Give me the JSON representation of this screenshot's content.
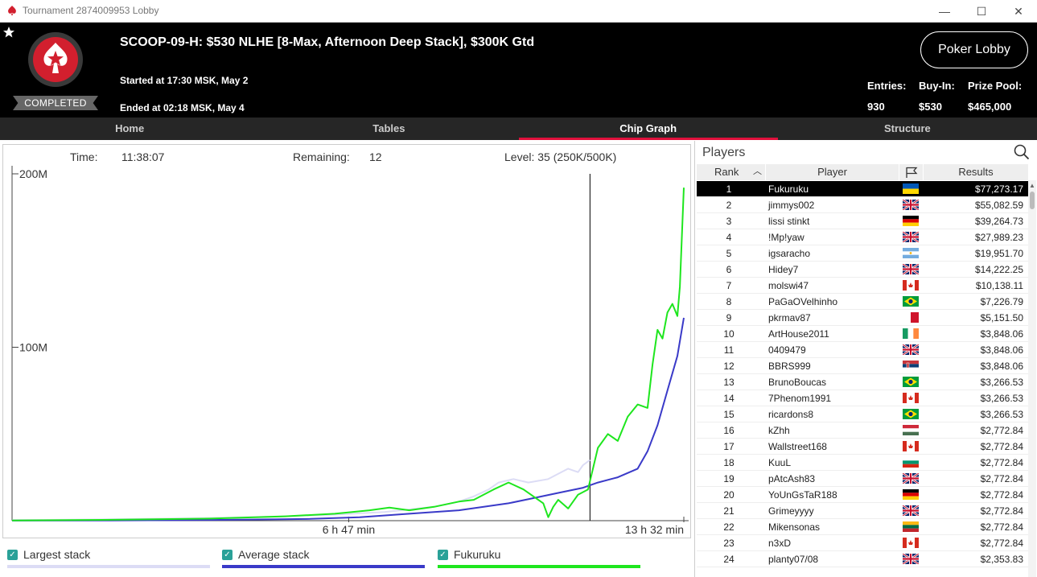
{
  "window": {
    "title": "Tournament 2874009953 Lobby",
    "controls": {
      "minimize": "—",
      "maximize": "☐",
      "close": "✕"
    }
  },
  "header": {
    "status_badge": "COMPLETED",
    "title": "SCOOP-09-H: $530 NLHE [8-Max, Afternoon Deep Stack], $300K Gtd",
    "started": "Started at 17:30 MSK, May 2",
    "ended": "Ended at 02:18 MSK, May 4",
    "lobby_button": "Poker Lobby",
    "stats": [
      {
        "label": "Entries:",
        "value": "930"
      },
      {
        "label": "Buy-In:",
        "value": "$530"
      },
      {
        "label": "Prize Pool:",
        "value": "$465,000"
      }
    ]
  },
  "tabs": [
    {
      "label": "Home",
      "active": false
    },
    {
      "label": "Tables",
      "active": false
    },
    {
      "label": "Chip Graph",
      "active": true
    },
    {
      "label": "Structure",
      "active": false
    }
  ],
  "chart_info": {
    "time_label": "Time:",
    "time_value": "11:38:07",
    "remaining_label": "Remaining:",
    "remaining_value": "12",
    "level_text": "Level: 35 (250K/500K)"
  },
  "chart_data": {
    "type": "line",
    "xlabel": "",
    "ylabel": "",
    "x_unit": "hours",
    "xlim": [
      0,
      13.53
    ],
    "ylim": [
      0,
      200
    ],
    "y_unit": "M chips",
    "y_ticks": [
      {
        "value": 100,
        "label": "100M"
      },
      {
        "value": 200,
        "label": "200M"
      }
    ],
    "x_ticks": [
      {
        "value": 6.78,
        "label": "6 h 47 min"
      },
      {
        "value": 13.53,
        "label": "13 h 32 min"
      }
    ],
    "cursor_x": 11.64,
    "grid": false,
    "legend_position": "bottom",
    "series": [
      {
        "name": "Largest stack",
        "color": "#dcdcf5",
        "x": [
          0,
          2,
          4,
          5.5,
          6.5,
          7.5,
          8.5,
          9.0,
          9.3,
          9.6,
          9.8,
          10.1,
          10.4,
          10.8,
          11.0,
          11.2,
          11.4,
          11.5,
          11.64
        ],
        "values": [
          0.3,
          0.8,
          1.5,
          2.5,
          3.5,
          5,
          8,
          11,
          14,
          18,
          22,
          24,
          22,
          24,
          27,
          30,
          28,
          32,
          35
        ]
      },
      {
        "name": "Average stack",
        "color": "#3a3ac8",
        "x": [
          0,
          2,
          4,
          6,
          7,
          8,
          9,
          9.5,
          10,
          10.5,
          11,
          11.5,
          11.8,
          12.2,
          12.6,
          12.8,
          13.0,
          13.2,
          13.4,
          13.53
        ],
        "values": [
          0.05,
          0.15,
          0.4,
          1.0,
          2,
          4,
          6,
          8,
          10,
          13,
          16,
          19,
          22,
          25,
          30,
          40,
          55,
          75,
          95,
          117
        ]
      },
      {
        "name": "Fukuruku",
        "color": "#1ee61e",
        "x": [
          0,
          2,
          4,
          5.5,
          6.5,
          7.2,
          7.6,
          8.0,
          8.5,
          9.0,
          9.3,
          9.7,
          10.0,
          10.3,
          10.5,
          10.7,
          10.8,
          10.9,
          11.0,
          11.2,
          11.4,
          11.6,
          11.8,
          12.0,
          12.2,
          12.4,
          12.6,
          12.8,
          12.9,
          13.0,
          13.1,
          13.2,
          13.3,
          13.4,
          13.45,
          13.53
        ],
        "values": [
          0.1,
          0.5,
          1.2,
          2.5,
          4,
          6,
          7.5,
          6,
          8,
          11,
          12,
          18,
          22,
          18,
          14,
          10,
          2,
          8,
          12,
          7,
          15,
          18,
          42,
          50,
          46,
          60,
          67,
          65,
          90,
          110,
          105,
          120,
          125,
          118,
          135,
          192
        ]
      }
    ]
  },
  "legend": [
    {
      "label": "Largest stack",
      "color": "#dcdcf5"
    },
    {
      "label": "Average stack",
      "color": "#3a3ac8"
    },
    {
      "label": "Fukuruku",
      "color": "#1ee61e"
    }
  ],
  "players": {
    "title": "Players",
    "headers": {
      "rank": "Rank",
      "player": "Player",
      "results": "Results"
    },
    "rows": [
      {
        "rank": "1",
        "name": "Fukuruku",
        "flag": "ua",
        "result": "$77,273.17",
        "selected": true
      },
      {
        "rank": "2",
        "name": "jimmys002",
        "flag": "gb",
        "result": "$55,082.59"
      },
      {
        "rank": "3",
        "name": "lissi stinkt",
        "flag": "de",
        "result": "$39,264.73"
      },
      {
        "rank": "4",
        "name": "!Mp!yaw",
        "flag": "gb",
        "result": "$27,989.23"
      },
      {
        "rank": "5",
        "name": "igsaracho",
        "flag": "ar",
        "result": "$19,951.70"
      },
      {
        "rank": "6",
        "name": "Hidey7",
        "flag": "gb",
        "result": "$14,222.25"
      },
      {
        "rank": "7",
        "name": "molswi47",
        "flag": "ca",
        "result": "$10,138.11"
      },
      {
        "rank": "8",
        "name": "PaGaOVelhinho",
        "flag": "br",
        "result": "$7,226.79"
      },
      {
        "rank": "9",
        "name": "pkrmav87",
        "flag": "mt",
        "result": "$5,151.50"
      },
      {
        "rank": "10",
        "name": "ArtHouse2011",
        "flag": "ie",
        "result": "$3,848.06"
      },
      {
        "rank": "11",
        "name": "0409479",
        "flag": "gb",
        "result": "$3,848.06"
      },
      {
        "rank": "12",
        "name": "BBRS999",
        "flag": "rs",
        "result": "$3,848.06"
      },
      {
        "rank": "13",
        "name": "BrunoBoucas",
        "flag": "br",
        "result": "$3,266.53"
      },
      {
        "rank": "14",
        "name": "7Phenom1991",
        "flag": "ca",
        "result": "$3,266.53"
      },
      {
        "rank": "15",
        "name": "ricardons8",
        "flag": "br",
        "result": "$3,266.53"
      },
      {
        "rank": "16",
        "name": "kZhh",
        "flag": "hu",
        "result": "$2,772.84"
      },
      {
        "rank": "17",
        "name": "Wallstreet168",
        "flag": "ca",
        "result": "$2,772.84"
      },
      {
        "rank": "18",
        "name": "KuuL",
        "flag": "bg",
        "result": "$2,772.84"
      },
      {
        "rank": "19",
        "name": "pAtcAsh83",
        "flag": "gb",
        "result": "$2,772.84"
      },
      {
        "rank": "20",
        "name": "YoUnGsTaR188",
        "flag": "de",
        "result": "$2,772.84"
      },
      {
        "rank": "21",
        "name": "Grimeyyyy",
        "flag": "gb",
        "result": "$2,772.84"
      },
      {
        "rank": "22",
        "name": "Mikensonas",
        "flag": "lt",
        "result": "$2,772.84"
      },
      {
        "rank": "23",
        "name": "n3xD",
        "flag": "ca",
        "result": "$2,772.84"
      },
      {
        "rank": "24",
        "name": "planty07/08",
        "flag": "gb",
        "result": "$2,353.83"
      }
    ]
  }
}
